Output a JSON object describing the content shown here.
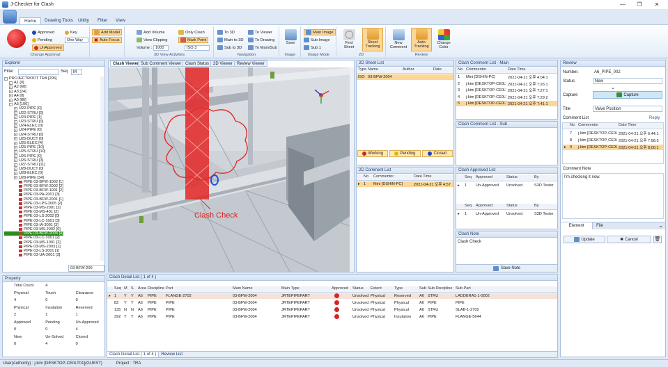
{
  "window": {
    "title": "J-Checker for Clash"
  },
  "ribbon_tabs": [
    "Home",
    "Drawing Tools",
    "Utility",
    "Filter",
    "View"
  ],
  "ribbon": {
    "change_approval": {
      "approved": "Approved",
      "pending": "Pending",
      "unapproved": "UnApproved",
      "key": "Key",
      "one_way": "One Way",
      "label": "Change Approval"
    },
    "model": {
      "add_model": "Add Model",
      "auto_focus": "Auto Focus"
    },
    "view3d": {
      "add_volume": "Add Volume",
      "view_clipping": "View Clipping",
      "volume_label": "Volume :",
      "volume_value": "1000",
      "only_clash": "Only Clash",
      "mark_point": "Mark Point",
      "iso": "ISO 3",
      "label": "3D View Activities"
    },
    "navigation": {
      "to_3d": "To 3D",
      "main_to_3d": "Main to 3D",
      "sub_to_3d": "Sub to 3D",
      "to_viewer": "To Viewer",
      "to_drawing": "To Drawing",
      "to_main_sub": "To Main/Sub",
      "label": "Navigation"
    },
    "image": {
      "save": "Save",
      "label": "Image"
    },
    "image_mode": {
      "main_image": "Main Image",
      "sub_image": "Sub Image",
      "sub1": "Sub 1",
      "label": "Image Mode"
    },
    "twod": {
      "find_sheet": "Find Sheet",
      "sheet_tracking": "Sheet Tracking",
      "label": "2D"
    },
    "review": {
      "new_comment": "New Comment",
      "auto_tracking": "Auto Tracking",
      "change_color": "Change Color",
      "label": "Review"
    }
  },
  "explorer": {
    "title": "Explorer",
    "filter_label": "Filter :",
    "seq_label": "Seq",
    "seq_value": "M",
    "bottom_value": "03-BFW-200",
    "items": [
      {
        "text": "PROJECTROOT TRA [296]",
        "indent": 0,
        "kind": "root"
      },
      {
        "text": "A1 [0]",
        "indent": 1,
        "kind": "folder"
      },
      {
        "text": "A2 [68]",
        "indent": 1,
        "kind": "folder"
      },
      {
        "text": "A3 [24]",
        "indent": 1,
        "kind": "folder"
      },
      {
        "text": "A4 [0]",
        "indent": 1,
        "kind": "folder"
      },
      {
        "text": "A5 [86]",
        "indent": 1,
        "kind": "folder"
      },
      {
        "text": "A6 [106]",
        "indent": 1,
        "kind": "folder"
      },
      {
        "text": "U22-PIPE [0]",
        "indent": 2,
        "kind": "folder"
      },
      {
        "text": "U22-STRU [0]",
        "indent": 2,
        "kind": "folder"
      },
      {
        "text": "U23-PIPE [1]",
        "indent": 2,
        "kind": "folder"
      },
      {
        "text": "U23-STRU [0]",
        "indent": 2,
        "kind": "folder"
      },
      {
        "text": "U24-ELEC [0]",
        "indent": 2,
        "kind": "folder"
      },
      {
        "text": "U24-PIPE [0]",
        "indent": 2,
        "kind": "folder"
      },
      {
        "text": "U24-STRU [0]",
        "indent": 2,
        "kind": "folder"
      },
      {
        "text": "U25-DUCT [0]",
        "indent": 2,
        "kind": "folder"
      },
      {
        "text": "U25-ELEC [4]",
        "indent": 2,
        "kind": "folder"
      },
      {
        "text": "U25-PIPE [10]",
        "indent": 2,
        "kind": "folder"
      },
      {
        "text": "U25-STRU [10]",
        "indent": 2,
        "kind": "folder"
      },
      {
        "text": "U26-PIPE [0]",
        "indent": 2,
        "kind": "folder"
      },
      {
        "text": "U26-STRU [3]",
        "indent": 2,
        "kind": "folder"
      },
      {
        "text": "U27-STRU [11]",
        "indent": 2,
        "kind": "folder"
      },
      {
        "text": "U28-DUCT [0]",
        "indent": 2,
        "kind": "folder"
      },
      {
        "text": "U28-ELEC [0]",
        "indent": 2,
        "kind": "folder"
      },
      {
        "text": "U28-PIPE [34]",
        "indent": 2,
        "kind": "folder"
      },
      {
        "text": "PIPE 03-BFW-1002 [1]",
        "indent": 3,
        "kind": "pipe"
      },
      {
        "text": "PIPE 03-BFW-2002 [2]",
        "indent": 3,
        "kind": "pipe"
      },
      {
        "text": "PIPE 03-BFW-1001 [2]",
        "indent": 3,
        "kind": "pipe"
      },
      {
        "text": "PIPE 03-PA-2001 [3]",
        "indent": 3,
        "kind": "pipe"
      },
      {
        "text": "PIPE 03-BFW-2001 [1]",
        "indent": 3,
        "kind": "pipe"
      },
      {
        "text": "PIPE 03-LPS-2005 [2]",
        "indent": 3,
        "kind": "pipe"
      },
      {
        "text": "PIPE 03-MS-2001 [2]",
        "indent": 3,
        "kind": "pipe"
      },
      {
        "text": "PIPE 03-MS-401 [2]",
        "indent": 3,
        "kind": "pipe"
      },
      {
        "text": "PIPE 03-LS-2002 [0]",
        "indent": 3,
        "kind": "pipe"
      },
      {
        "text": "PIPE 03-LC-1001 [3]",
        "indent": 3,
        "kind": "pipe"
      },
      {
        "text": "PIPE 03-IA-3001 [3]",
        "indent": 3,
        "kind": "pipe"
      },
      {
        "text": "PIPE 03-MS-2002 [0]",
        "indent": 3,
        "kind": "pipe"
      },
      {
        "text": "PIPE 03-BFW-2004 [4]",
        "indent": 3,
        "kind": "pipe",
        "selected": true
      },
      {
        "text": "PIPE 03-LC-1001 [2]",
        "indent": 3,
        "kind": "pipe"
      },
      {
        "text": "PIPE 03-MS-1001 [2]",
        "indent": 3,
        "kind": "pipe"
      },
      {
        "text": "PIPE 03-MS-2003 [1]",
        "indent": 3,
        "kind": "pipe"
      },
      {
        "text": "PIPE 03-LS-2001 [1]",
        "indent": 3,
        "kind": "pipe"
      },
      {
        "text": "PIPE 03-UA-2001 [3]",
        "indent": 3,
        "kind": "pipe"
      }
    ]
  },
  "viewer_tabs": [
    "Clash Viewer",
    "Sub Comment Viewer",
    "Clash Status",
    "2D Viewer",
    "Review Viewer"
  ],
  "viewer": {
    "annotation": "Clash Check"
  },
  "sheet_list": {
    "title": "2D Sheet List",
    "columns": [
      "Type",
      "Name",
      "Author",
      "Date"
    ],
    "rows": [
      [
        "ISO",
        "03-BFW-2004",
        "",
        ""
      ]
    ],
    "status_working": "Working",
    "status_pending": "Pending",
    "status_closed": "Closed"
  },
  "comment_2d": {
    "title": "2D Comment List",
    "columns": [
      "No",
      "Commentor",
      "Date Time"
    ],
    "rows": [
      [
        "1",
        "Mini [DSHIN-PC]",
        "2021-04-21 오후 4:57"
      ]
    ]
  },
  "clash_comment_main": {
    "title": "Clash Comment List - Main",
    "columns": [
      "No",
      "Commentor",
      "Date Time"
    ],
    "rows": [
      [
        "1",
        "Mini [DSHIN-PC]",
        "2021-04-21 오후 4:04:1"
      ],
      [
        "2",
        "j.kim [DESKTOP-CE0LT01",
        "2021-04-21 오후 7:26:1"
      ],
      [
        "3",
        "j.kim [DESKTOP-CE0LT01",
        "2021-04-21 오후 7:27:1"
      ],
      [
        "4",
        "j.kim [DESKTOP-CE0LT01",
        "2021-04-21 오후 7:29:2"
      ],
      [
        "5",
        "j.kim [DESKTOP-CE0LT01",
        "2021-04-21 오후 7:41:1"
      ]
    ]
  },
  "clash_comment_sub": {
    "title": "Clash Comment List - Sub"
  },
  "clash_approved": {
    "title": "Clash Approved List",
    "columns": [
      "Seq",
      "Approved",
      "Status",
      "By"
    ],
    "rows_top": [
      [
        "1",
        "Un-Approved",
        "Unsolved",
        "S3D Tester"
      ]
    ],
    "rows_bottom": [
      [
        "1",
        "Un-Approved",
        "Unsolved",
        "S3D Tester"
      ]
    ]
  },
  "clash_note": {
    "title": "Clash Note",
    "text": "Clash Check",
    "save_label": "Save Note"
  },
  "review": {
    "title": "Review",
    "number_label": "Number.",
    "number_value": "A6_PIPE_002",
    "status_label": "Status",
    "status_value": "New",
    "capture_label": "Capture",
    "capture_button": "Capture",
    "title_label": "Title",
    "title_value": "Valve Position",
    "comment_list_label": "Comment List",
    "reply": "Reply",
    "columns": [
      "No",
      "Commentor",
      "Date Time"
    ],
    "rows": [
      [
        "7",
        "j.kim [DESKTOP-CE0LT01]",
        "2021-04-21 오후 6:44:10"
      ],
      [
        "8",
        "j.kim [DESKTOP-CE0LT01]",
        "2021-04-21 오후 7:58:52"
      ],
      [
        "9",
        "j.kim [DESKTOP-CE0LT01]",
        "2021-04-21 오후 8:00:14"
      ]
    ],
    "comment_note_label": "Comment Note",
    "comment_note_text": "I'm checking it now.",
    "tab_element": "Element",
    "tab_file": "File",
    "update_button": "Update",
    "cancel_button": "Cancel"
  },
  "property": {
    "title": "Property",
    "rows": [
      [
        "Total Count",
        "4",
        ""
      ],
      [
        "Physical",
        "Touch",
        "Clearance"
      ],
      [
        "4",
        "0",
        "0"
      ],
      [
        "Physical",
        "Insulation",
        "Reserved"
      ],
      [
        "2",
        "1",
        "1"
      ],
      [
        "Approved",
        "Pending",
        "Un-Approved"
      ],
      [
        "0",
        "0",
        "4"
      ],
      [
        "New",
        "Un-Solved",
        "Closed"
      ],
      [
        "0",
        "4",
        "0"
      ]
    ]
  },
  "clash_detail": {
    "title": "Clash Detail List ( 1 of 4 )",
    "columns": [
      "Seq",
      "M",
      "S",
      "Area",
      "Discipline",
      "Part",
      "Main Name",
      "Main Type",
      "Approved",
      "Status",
      "Extent",
      "Type",
      "Sub Area",
      "Sub Discipline",
      "Sub Part"
    ],
    "rows": [
      [
        "1",
        "Y",
        "Y",
        "A6",
        "PIPE",
        "FLANGE-2702",
        "03-BFW-2004",
        "JRTEPIPEPART",
        "",
        "Unsolved",
        "Physical",
        "Reserved",
        "A6",
        "STRU",
        "LADDERA1-1-0002"
      ],
      [
        "82",
        "Y",
        "Y",
        "A6",
        "PIPE",
        "PIPE",
        "03-BFW-2004",
        "JRTEPIPEPART",
        "",
        "Unsolved",
        "Physical",
        "Physical",
        "A6",
        "PIPE",
        "PIPE"
      ],
      [
        "135",
        "N",
        "N",
        "A6",
        "PIPE",
        "PIPE",
        "03-BFW-2004",
        "JRTEPIPEPART",
        "",
        "Unsolved",
        "Physical",
        "Physical",
        "A6",
        "STRU",
        "SLAB-1-2702"
      ],
      [
        "392",
        "Y",
        "Y",
        "A6",
        "PIPE",
        "PIPE",
        "03-BFW-2004",
        "JRTEPIPEPART",
        "",
        "Unsolved",
        "Physical",
        "Insulation",
        "A6",
        "PIPE",
        "FLANGE-5644"
      ]
    ],
    "bottom_tab1": "Clash Detail List ( 1 of 4 )",
    "bottom_tab2": "Review List"
  },
  "statusbar": {
    "user": "User(Authority) : j.kim [DESKTOP-CE0LT01](GUEST)",
    "project": "Project : TRA"
  },
  "colors": {
    "accent": "#fbd79a",
    "selected_tree": "#2b8c1c",
    "clash_red": "#d62424"
  }
}
